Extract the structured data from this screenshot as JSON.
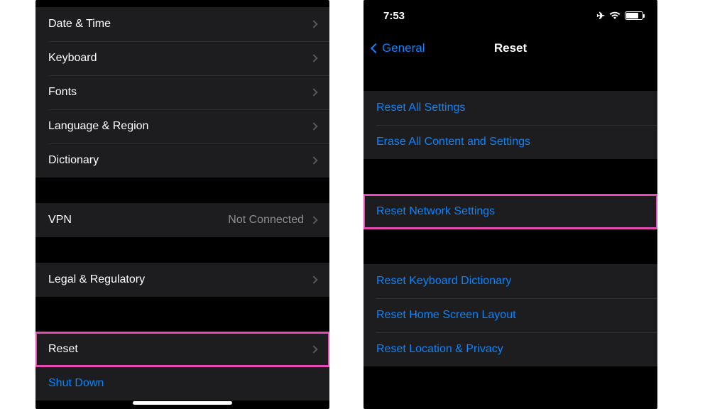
{
  "left": {
    "group1": [
      {
        "label": "Date & Time"
      },
      {
        "label": "Keyboard"
      },
      {
        "label": "Fonts"
      },
      {
        "label": "Language & Region"
      },
      {
        "label": "Dictionary"
      }
    ],
    "vpn": {
      "label": "VPN",
      "detail": "Not Connected"
    },
    "legal": {
      "label": "Legal & Regulatory"
    },
    "reset": {
      "label": "Reset"
    },
    "shutdown": {
      "label": "Shut Down"
    }
  },
  "right": {
    "status_time": "7:53",
    "nav_back": "General",
    "nav_title": "Reset",
    "group1": [
      {
        "label": "Reset All Settings"
      },
      {
        "label": "Erase All Content and Settings"
      }
    ],
    "group2": [
      {
        "label": "Reset Network Settings"
      }
    ],
    "group3": [
      {
        "label": "Reset Keyboard Dictionary"
      },
      {
        "label": "Reset Home Screen Layout"
      },
      {
        "label": "Reset Location & Privacy"
      }
    ]
  }
}
